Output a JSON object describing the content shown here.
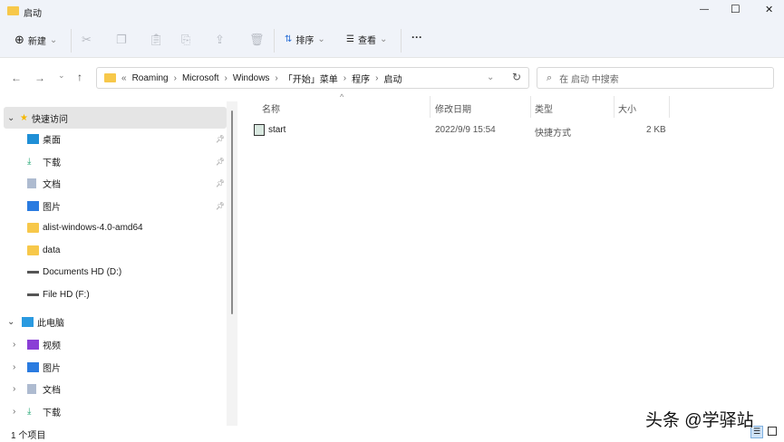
{
  "window": {
    "title": "启动",
    "minimize": "—",
    "maximize": "☐",
    "close": "✕"
  },
  "toolbar": {
    "new_label": "新建",
    "sort_label": "排序",
    "view_label": "查看",
    "more": "···"
  },
  "nav": {
    "back": "←",
    "forward": "→",
    "recent": "⌄",
    "up": "↑"
  },
  "address": {
    "overflow": "«",
    "crumbs": [
      "Roaming",
      "Microsoft",
      "Windows",
      "「开始」菜单",
      "程序",
      "启动"
    ],
    "sep": "›",
    "refresh": "↻",
    "dropdown": "⌄"
  },
  "search": {
    "placeholder": "在 启动 中搜索"
  },
  "sidebar": {
    "quick_access": "快速访问",
    "quick_items": [
      {
        "label": "桌面",
        "pinned": true
      },
      {
        "label": "下载",
        "pinned": true
      },
      {
        "label": "文档",
        "pinned": true
      },
      {
        "label": "图片",
        "pinned": true
      },
      {
        "label": "alist-windows-4.0-amd64"
      },
      {
        "label": "data"
      },
      {
        "label": "Documents HD (D:)"
      },
      {
        "label": "File HD (F:)"
      }
    ],
    "this_pc": "此电脑",
    "pc_items": [
      {
        "label": "视频"
      },
      {
        "label": "图片"
      },
      {
        "label": "文档"
      },
      {
        "label": "下载"
      }
    ]
  },
  "columns": {
    "name": "名称",
    "modified": "修改日期",
    "type": "类型",
    "size": "大小"
  },
  "files": [
    {
      "name": "start",
      "modified": "2022/9/9 15:54",
      "type": "快捷方式",
      "size": "2 KB"
    }
  ],
  "status": {
    "count": "1 个项目"
  },
  "watermark": "头条 @学驿站"
}
